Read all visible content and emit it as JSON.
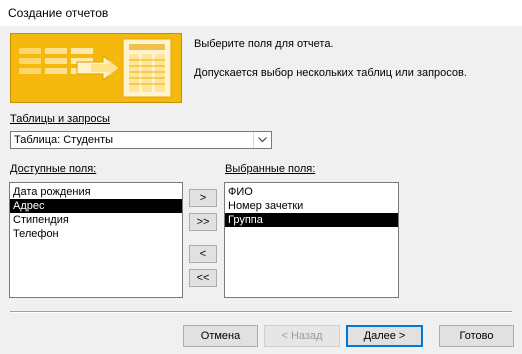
{
  "window": {
    "title": "Создание отчетов"
  },
  "instructions": {
    "line1": "Выберите поля для отчета.",
    "line2": "Допускается выбор нескольких таблиц или запросов."
  },
  "source": {
    "label": "Таблицы и запросы",
    "selected": "Таблица: Студенты"
  },
  "available": {
    "label": "Доступные поля:",
    "items": [
      "Дата рождения",
      "Адрес",
      "Стипендия",
      "Телефон"
    ],
    "selected_index": 1
  },
  "selected_fields": {
    "label": "Выбранные поля:",
    "items": [
      "ФИО",
      "Номер зачетки",
      "Группа"
    ],
    "selected_index": 2
  },
  "move_buttons": {
    "add_one": ">",
    "add_all": ">>",
    "remove_one": "<",
    "remove_all": "<<"
  },
  "footer": {
    "cancel": "Отмена",
    "back": "< Назад",
    "next": "Далее >",
    "finish": "Готово"
  },
  "colors": {
    "banner": "#f5b80c",
    "selection": "#000000",
    "accent": "#0078d7"
  }
}
